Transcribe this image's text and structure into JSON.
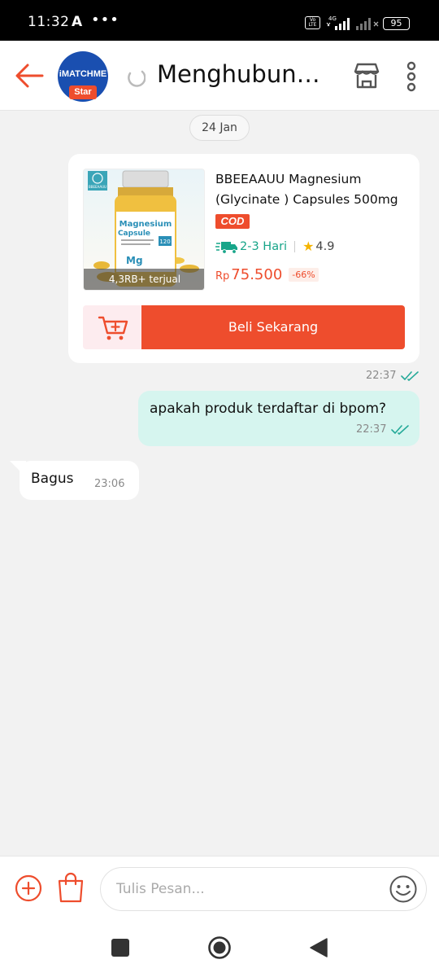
{
  "status_bar": {
    "time": "11:32",
    "indicator": "A",
    "more": "•••",
    "volte": "Vo LTE",
    "network": "4G",
    "battery": "95"
  },
  "header": {
    "avatar_brand": "iMATCHME",
    "avatar_badge": "Star",
    "title": "Menghubungkan...",
    "icons": [
      "back-arrow-icon",
      "loading-spinner-icon",
      "store-icon",
      "more-vertical-icon"
    ]
  },
  "chat": {
    "date_label": "24 Jan",
    "product_card": {
      "title": "BBEEAAUU Magnesium (Glycinate ) Capsules 500mg",
      "cod_label": "COD",
      "shipping": "2-3 Hari",
      "rating": "4.9",
      "sold": "4,3RB+ terjual",
      "currency": "Rp",
      "price": "75.500",
      "discount": "-66%",
      "buy_label": "Beli Sekarang",
      "time": "22:37",
      "product_image": {
        "brand_text": "BBEEAAUU",
        "name_line1": "Magnesium",
        "name_line2": "Capsule",
        "count": "120",
        "symbol": "Mg"
      }
    },
    "messages": [
      {
        "direction": "outgoing",
        "text": "apakah produk terdaftar di bpom?",
        "time": "22:37",
        "read": true
      },
      {
        "direction": "incoming",
        "text": "Bagus",
        "time": "23:06"
      }
    ]
  },
  "composer": {
    "placeholder": "Tulis Pesan...",
    "icons": [
      "plus-circle-icon",
      "shopping-bag-icon",
      "emoji-icon"
    ]
  },
  "colors": {
    "accent": "#ee4d2d",
    "outgoing_bubble": "#d6f5ef",
    "shipping_green": "#17a589",
    "read_tick": "#26aa99"
  }
}
